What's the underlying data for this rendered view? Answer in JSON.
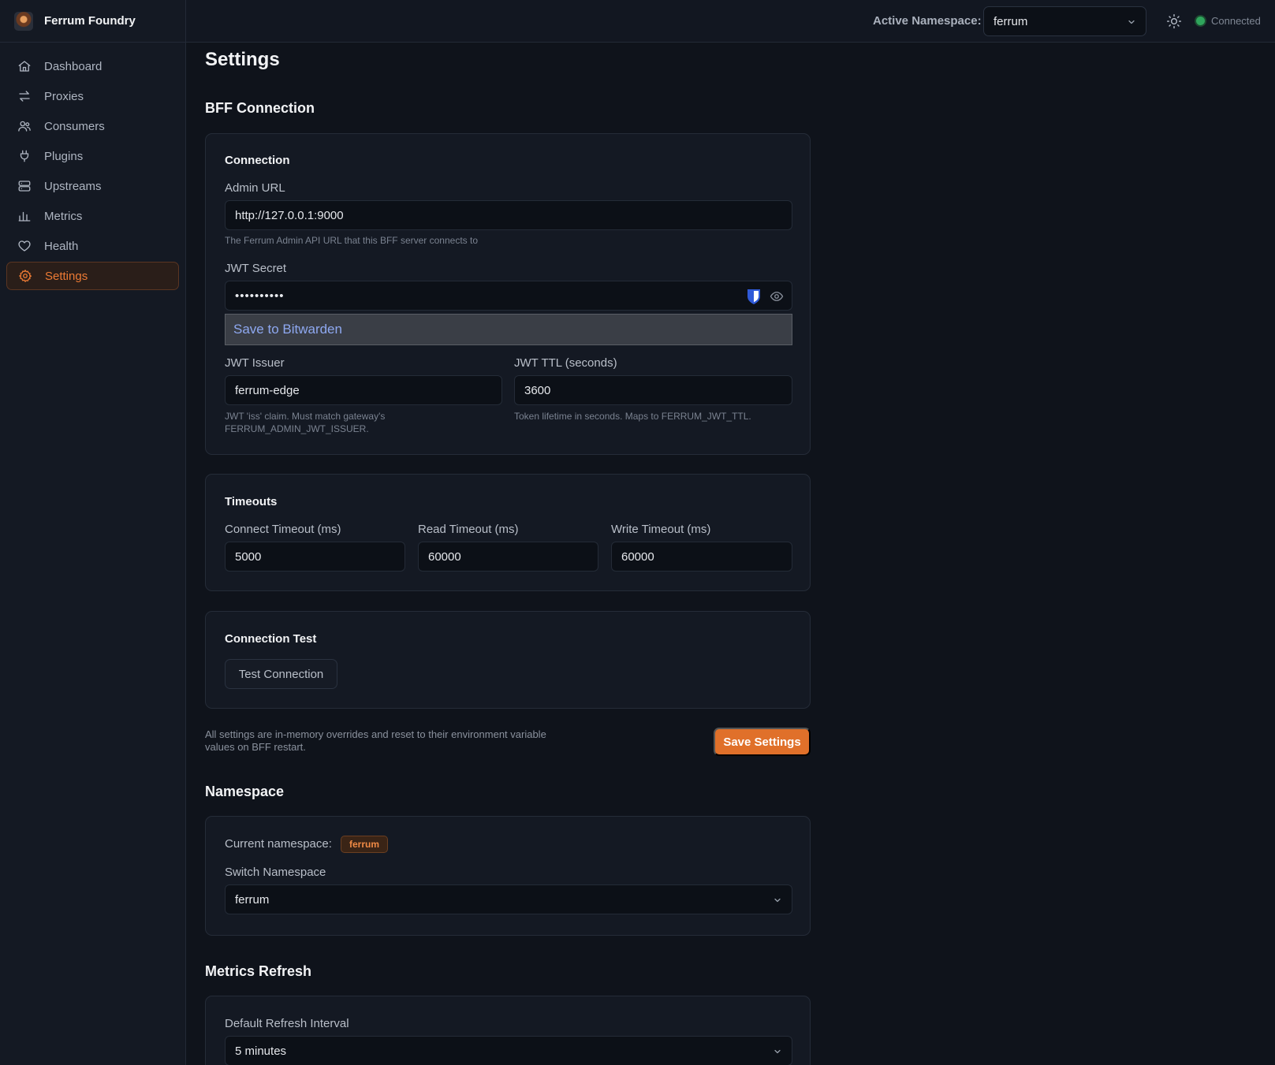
{
  "brand": {
    "name": "Ferrum Foundry"
  },
  "nav": {
    "items": [
      {
        "label": "Dashboard",
        "icon": "home-icon"
      },
      {
        "label": "Proxies",
        "icon": "arrows-exchange-icon"
      },
      {
        "label": "Consumers",
        "icon": "users-icon"
      },
      {
        "label": "Plugins",
        "icon": "plug-icon"
      },
      {
        "label": "Upstreams",
        "icon": "server-stack-icon"
      },
      {
        "label": "Metrics",
        "icon": "bar-chart-icon"
      },
      {
        "label": "Health",
        "icon": "heart-icon"
      },
      {
        "label": "Settings",
        "icon": "gear-icon",
        "active": true
      }
    ]
  },
  "header": {
    "namespace_label": "Active Namespace:",
    "namespace_value": "ferrum",
    "status": "Connected"
  },
  "page": {
    "title": "Settings"
  },
  "bff": {
    "title": "BFF Connection",
    "connection": {
      "title": "Connection",
      "admin_url_label": "Admin URL",
      "admin_url_value": "http://127.0.0.1:9000",
      "admin_url_help": "The Ferrum Admin API URL that this BFF server connects to",
      "jwt_secret_label": "JWT Secret",
      "jwt_secret_value": "••••••••••",
      "bitwarden_prompt": "Save to Bitwarden",
      "jwt_issuer_label": "JWT Issuer",
      "jwt_issuer_value": "ferrum-edge",
      "jwt_issuer_help": "JWT 'iss' claim. Must match gateway's FERRUM_ADMIN_JWT_ISSUER.",
      "jwt_ttl_label": "JWT TTL (seconds)",
      "jwt_ttl_value": "3600",
      "jwt_ttl_help": "Token lifetime in seconds. Maps to FERRUM_JWT_TTL."
    },
    "timeouts": {
      "title": "Timeouts",
      "connect_label": "Connect Timeout (ms)",
      "connect_value": "5000",
      "read_label": "Read Timeout (ms)",
      "read_value": "60000",
      "write_label": "Write Timeout (ms)",
      "write_value": "60000"
    },
    "test": {
      "title": "Connection Test",
      "button": "Test Connection"
    },
    "note": "All settings are in-memory overrides and reset to their environment variable values on BFF restart.",
    "save_button": "Save Settings"
  },
  "namespace": {
    "title": "Namespace",
    "current_label": "Current namespace:",
    "current_value": "ferrum",
    "switch_label": "Switch Namespace",
    "switch_value": "ferrum"
  },
  "metrics_refresh": {
    "title": "Metrics Refresh",
    "interval_label": "Default Refresh Interval",
    "interval_value": "5 minutes"
  },
  "colors": {
    "accent": "#e0702a",
    "status_ok": "#2fa55c",
    "background": "#0f131b"
  }
}
